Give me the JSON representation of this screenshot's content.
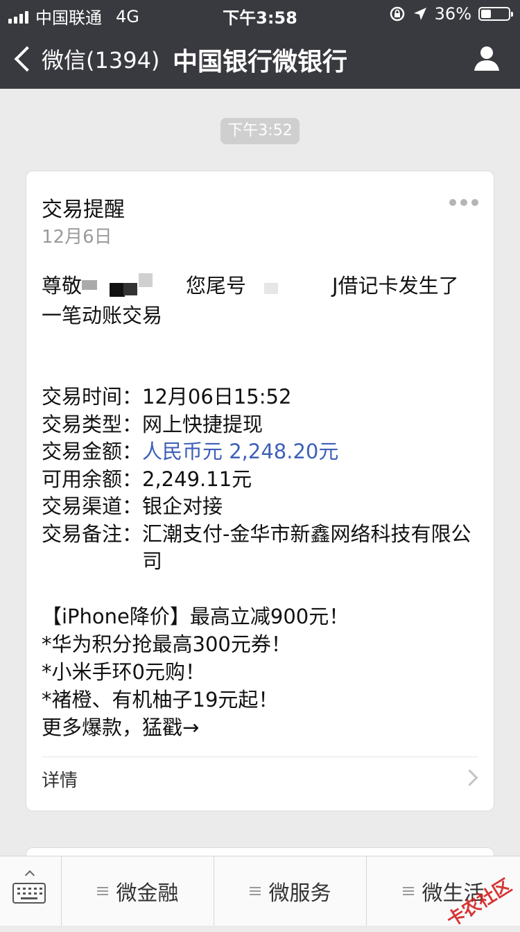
{
  "status_bar": {
    "carrier": "中国联通",
    "network": "4G",
    "time": "下午3:58",
    "battery": "36%",
    "battery_level": 0.36
  },
  "nav": {
    "back_label": "微信(1394)",
    "title": "中国银行微银行"
  },
  "chat": {
    "time_chip": "下午3:52"
  },
  "card": {
    "title": "交易提醒",
    "date": "12月6日",
    "greeting": "尊敬",
    "tail_text": "您尾号",
    "card_text": "J借记卡发生了",
    "line2": "一笔动账交易",
    "rows": [
      {
        "key": "交易时间：",
        "value": "12月06日15:52"
      },
      {
        "key": "交易类型：",
        "value": "网上快捷提现"
      },
      {
        "key": "交易金额：",
        "value": "人民币元 2,248.20元"
      },
      {
        "key": "可用余额：",
        "value": "2,249.11元"
      },
      {
        "key": "交易渠道：",
        "value": "银企对接"
      },
      {
        "key": "交易备注：",
        "value": "汇潮支付-金华市新鑫网络科技有限公司"
      }
    ],
    "promo": [
      "【iPhone降价】最高立减900元！",
      "*华为积分抢最高300元券！",
      "*小米手环0元购！",
      "*褚橙、有机柚子19元起！",
      "更多爆款，猛戳→"
    ],
    "details_label": "详情"
  },
  "tabbar": {
    "tabs": [
      "微金融",
      "微服务",
      "微生活"
    ]
  },
  "watermark": "卡农社区",
  "colors": {
    "header_bg": "#393a3f",
    "amount_blue": "#3d5fb8",
    "page_bg": "#ebebeb"
  }
}
